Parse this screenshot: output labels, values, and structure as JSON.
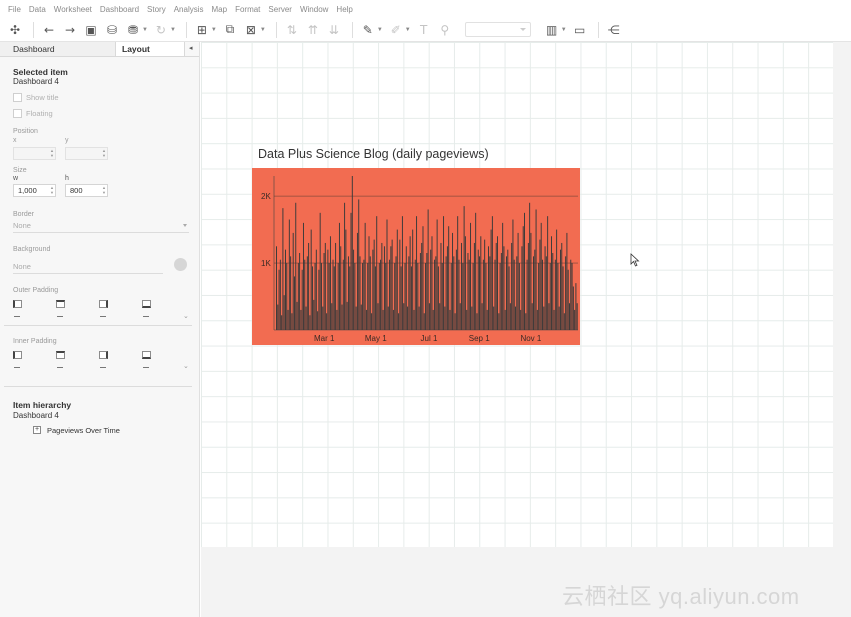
{
  "menu": [
    "File",
    "Data",
    "Worksheet",
    "Dashboard",
    "Story",
    "Analysis",
    "Map",
    "Format",
    "Server",
    "Window",
    "Help"
  ],
  "toolbar": {
    "icons": [
      "tableau-logo-icon",
      "undo-icon",
      "redo-icon",
      "save-icon",
      "new-datasource-icon",
      "pause-update-icon",
      "refresh-icon",
      "new-worksheet-icon",
      "duplicate-sheet-icon",
      "clear-sheet-icon",
      "swap-icon",
      "sort-ascending-icon",
      "sort-descending-icon",
      "highlight-icon",
      "group-icon",
      "label-icon",
      "pin-icon",
      "fit-dropdown",
      "show-cards-icon",
      "presentation-icon",
      "share-icon"
    ]
  },
  "sidebar": {
    "tabs": {
      "dashboard": "Dashboard",
      "layout": "Layout"
    },
    "selected_item": {
      "title": "Selected item",
      "value": "Dashboard 4"
    },
    "show_title": "Show title",
    "floating": "Floating",
    "position": {
      "label": "Position",
      "x_label": "x",
      "y_label": "y",
      "x_value": "",
      "y_value": ""
    },
    "size": {
      "label": "Size",
      "w_label": "w",
      "h_label": "h",
      "w_value": "1,000",
      "h_value": "800"
    },
    "border": {
      "label": "Border",
      "value": "None"
    },
    "background": {
      "label": "Background",
      "value": "None"
    },
    "outer_padding": {
      "label": "Outer Padding"
    },
    "inner_padding": {
      "label": "Inner Padding"
    },
    "hierarchy": {
      "title": "Item hierarchy",
      "root": "Dashboard 4",
      "child": "Pageviews Over Time",
      "toggle": "+"
    }
  },
  "chart_data": {
    "type": "bar",
    "title": "Data Plus Science Blog (daily pageviews)",
    "xlabel": "",
    "ylabel": "",
    "ylim": [
      0,
      2300
    ],
    "y_ticks": [
      "1K",
      "2K"
    ],
    "x_ticks": [
      "Mar 1",
      "May 1",
      "Jul 1",
      "Sep 1",
      "Nov 1"
    ],
    "background": "#f26c51",
    "bar_color": "#3a3a3a",
    "values": [
      1250,
      380,
      900,
      1050,
      220,
      1820,
      520,
      1200,
      1000,
      300,
      1650,
      1100,
      250,
      1450,
      800,
      1900,
      420,
      1000,
      1150,
      300,
      900,
      1600,
      1050,
      350,
      1100,
      1300,
      220,
      1500,
      950,
      450,
      1000,
      1200,
      280,
      900,
      1750,
      1000,
      350,
      1150,
      1300,
      250,
      1200,
      1000,
      1400,
      400,
      1050,
      950,
      1300,
      300,
      1000,
      1600,
      1250,
      380,
      1050,
      1900,
      1500,
      420,
      1100,
      950,
      1750,
      2300,
      1200,
      1000,
      350,
      1450,
      1950,
      1100,
      380,
      1000,
      1050,
      1600,
      300,
      1000,
      1400,
      1100,
      250,
      1200,
      1350,
      950,
      1700,
      400,
      1000,
      1050,
      1300,
      300,
      1250,
      1000,
      1650,
      350,
      1050,
      1250,
      1350,
      300,
      1000,
      1100,
      1500,
      250,
      1350,
      950,
      1700,
      400,
      1000,
      1250,
      350,
      1100,
      1400,
      950,
      1500,
      300,
      1050,
      1700,
      1000,
      350,
      1150,
      1300,
      1550,
      250,
      1000,
      1150,
      1800,
      400,
      1200,
      1400,
      300,
      1050,
      1100,
      1650,
      950,
      400,
      1300,
      1000,
      1700,
      350,
      1100,
      1250,
      1550,
      300,
      1000,
      1450,
      1100,
      250,
      1200,
      1700,
      1050,
      400,
      1300,
      1000,
      1850,
      1400,
      300,
      1150,
      1050,
      1600,
      350,
      1000,
      1300,
      1750,
      250,
      1200,
      1100,
      1400,
      400,
      1050,
      1350,
      1000,
      300,
      1250,
      1100,
      1500,
      1700,
      350,
      1050,
      1300,
      1400,
      250,
      1000,
      1150,
      1600,
      1250,
      300,
      1100,
      1200,
      950,
      400,
      1300,
      1650,
      1050,
      350,
      1100,
      1450,
      1000,
      300,
      1250,
      1550,
      1750,
      250,
      1050,
      1300,
      1900,
      1450,
      400,
      1100,
      1200,
      1800,
      300,
      1000,
      1350,
      1600,
      1050,
      350,
      1250,
      1100,
      1700,
      400,
      1000,
      1400,
      1150,
      300,
      1050,
      1500,
      1000,
      350,
      1200,
      1300,
      950,
      250,
      1100,
      1450,
      900,
      400,
      1050,
      1000,
      650,
      300,
      700,
      400
    ]
  },
  "watermark": "云栖社区 yq.aliyun.com"
}
